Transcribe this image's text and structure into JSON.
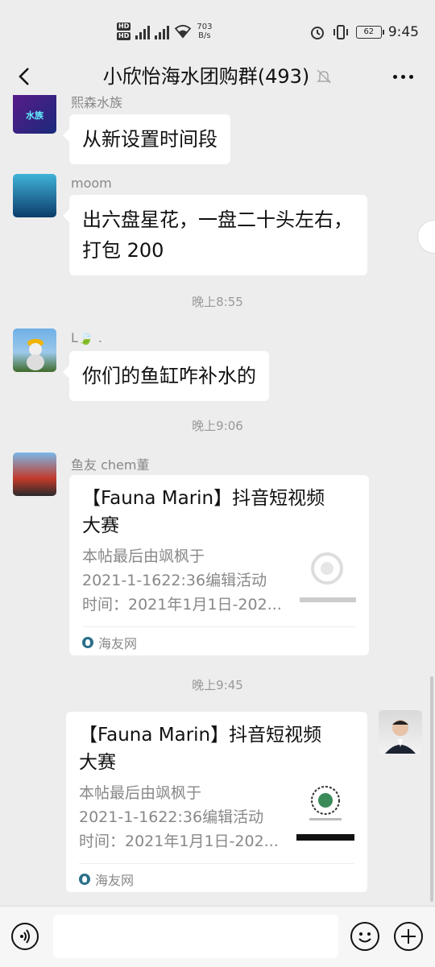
{
  "statusbar": {
    "network_speed_value": "703",
    "network_speed_unit": "B/s",
    "battery": "62",
    "time": "9:45"
  },
  "header": {
    "title": "小欣怡海水团购群(493)"
  },
  "messages": [
    {
      "sender": "熙森水族",
      "text": "从新设置时间段"
    },
    {
      "sender": "moom",
      "text_lines": [
        "出六盘星花，一盘二十头左右，",
        "打包 200"
      ]
    },
    {
      "time": "晚上8:55"
    },
    {
      "sender": "L🍃 .",
      "text": "你们的鱼缸咋补水的"
    },
    {
      "time": "晚上9:06"
    },
    {
      "sender": "鱼友 chem董",
      "card": {
        "title_lines": [
          "【Fauna Marin】抖音短视频",
          "大赛"
        ],
        "desc_lines": [
          "本帖最后由飒枫于",
          "2021-1-1622:36编辑活动",
          "时间：2021年1月1日-202..."
        ],
        "source": "海友网"
      }
    },
    {
      "time": "晚上9:45"
    },
    {
      "self": true,
      "card": {
        "title_lines": [
          "【Fauna Marin】抖音短视频",
          "大赛"
        ],
        "desc_lines": [
          "本帖最后由飒枫于",
          "2021-1-1622:36编辑活动",
          "时间：2021年1月1日-202..."
        ],
        "source": "海友网"
      }
    }
  ],
  "colors": {
    "background": "#ededed",
    "bubble": "#ffffff",
    "secondary_text": "#888888"
  },
  "icons": [
    "back-icon",
    "bell-off-icon",
    "more-icon",
    "voice-icon",
    "emoji-icon",
    "plus-icon"
  ]
}
